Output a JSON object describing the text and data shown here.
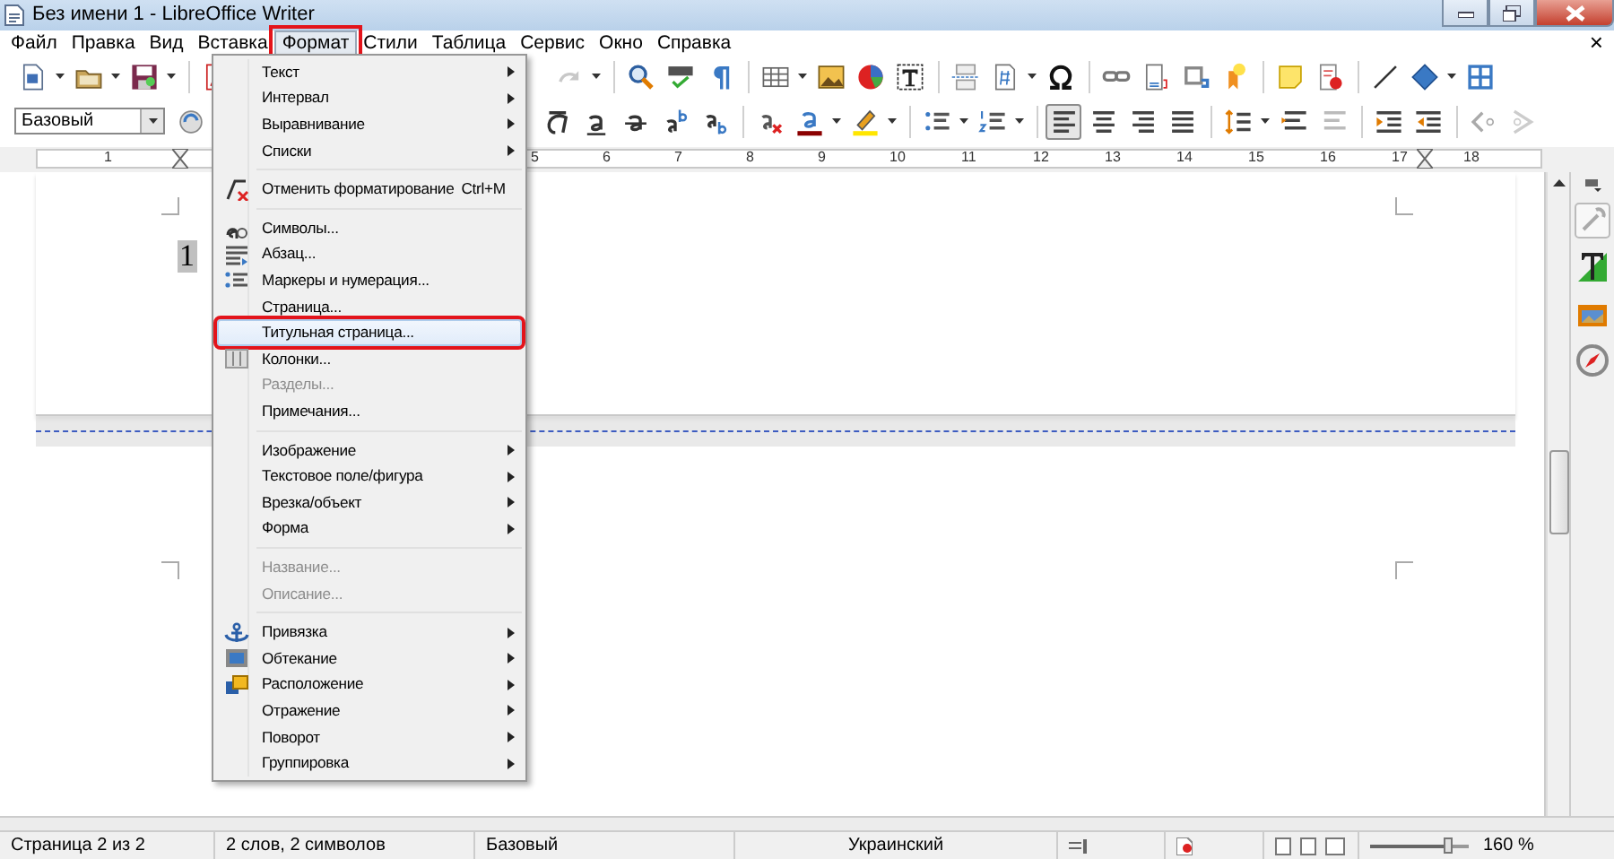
{
  "window": {
    "title": "Без имени 1 - LibreOffice Writer"
  },
  "menubar": [
    {
      "label": "Файл",
      "selected": false,
      "annotated": false
    },
    {
      "label": "Правка",
      "selected": false,
      "annotated": false
    },
    {
      "label": "Вид",
      "selected": false,
      "annotated": false
    },
    {
      "label": "Вставка",
      "selected": false,
      "annotated": false
    },
    {
      "label": "Формат",
      "selected": true,
      "annotated": true
    },
    {
      "label": "Стили",
      "selected": false,
      "annotated": false
    },
    {
      "label": "Таблица",
      "selected": false,
      "annotated": false
    },
    {
      "label": "Сервис",
      "selected": false,
      "annotated": false
    },
    {
      "label": "Окно",
      "selected": false,
      "annotated": false
    },
    {
      "label": "Справка",
      "selected": false,
      "annotated": false
    }
  ],
  "close_document": "×",
  "formatting_toolbar": {
    "paragraph_style": "Базовый",
    "align_left_pressed": true
  },
  "ruler": [
    {
      "label": "1"
    },
    {
      "label": "5"
    },
    {
      "label": "6"
    },
    {
      "label": "7"
    },
    {
      "label": "8"
    },
    {
      "label": "9"
    },
    {
      "label": "10"
    },
    {
      "label": "11"
    },
    {
      "label": "12"
    },
    {
      "label": "13"
    },
    {
      "label": "14"
    },
    {
      "label": "15"
    },
    {
      "label": "16"
    },
    {
      "label": "17"
    },
    {
      "label": "18"
    }
  ],
  "document": {
    "page_number_field": "1"
  },
  "format_menu": [
    {
      "kind": "item",
      "label": "Текст",
      "submenu": true,
      "disabled": false,
      "selected": false,
      "annotated": false
    },
    {
      "kind": "item",
      "label": "Интервал",
      "submenu": true,
      "disabled": false,
      "selected": false,
      "annotated": false
    },
    {
      "kind": "item",
      "label": "Выравнивание",
      "submenu": true,
      "disabled": false,
      "selected": false,
      "annotated": false
    },
    {
      "kind": "item",
      "label": "Списки",
      "submenu": true,
      "disabled": false,
      "selected": false,
      "annotated": false
    },
    {
      "kind": "separator"
    },
    {
      "kind": "item",
      "label": "Отменить форматирование",
      "shortcut": "Ctrl+M",
      "submenu": false,
      "disabled": false,
      "selected": false,
      "annotated": false
    },
    {
      "kind": "separator"
    },
    {
      "kind": "item",
      "label": "Символы...",
      "submenu": false,
      "disabled": false,
      "selected": false,
      "annotated": false
    },
    {
      "kind": "item",
      "label": "Абзац...",
      "submenu": false,
      "disabled": false,
      "selected": false,
      "annotated": false
    },
    {
      "kind": "item",
      "label": "Маркеры и нумерация...",
      "submenu": false,
      "disabled": false,
      "selected": false,
      "annotated": false
    },
    {
      "kind": "item",
      "label": "Страница...",
      "submenu": false,
      "disabled": false,
      "selected": false,
      "annotated": false
    },
    {
      "kind": "item",
      "label": "Титульная страница...",
      "submenu": false,
      "disabled": false,
      "selected": true,
      "annotated": true
    },
    {
      "kind": "item",
      "label": "Колонки...",
      "submenu": false,
      "disabled": false,
      "selected": false,
      "annotated": false
    },
    {
      "kind": "item",
      "label": "Разделы...",
      "submenu": false,
      "disabled": true,
      "selected": false,
      "annotated": false
    },
    {
      "kind": "item",
      "label": "Примечания...",
      "submenu": false,
      "disabled": false,
      "selected": false,
      "annotated": false
    },
    {
      "kind": "separator"
    },
    {
      "kind": "item",
      "label": "Изображение",
      "submenu": true,
      "disabled": false,
      "selected": false,
      "annotated": false
    },
    {
      "kind": "item",
      "label": "Текстовое поле/фигура",
      "submenu": true,
      "disabled": false,
      "selected": false,
      "annotated": false
    },
    {
      "kind": "item",
      "label": "Врезка/объект",
      "submenu": true,
      "disabled": false,
      "selected": false,
      "annotated": false
    },
    {
      "kind": "item",
      "label": "Форма",
      "submenu": true,
      "disabled": false,
      "selected": false,
      "annotated": false
    },
    {
      "kind": "separator"
    },
    {
      "kind": "item",
      "label": "Название...",
      "submenu": false,
      "disabled": true,
      "selected": false,
      "annotated": false
    },
    {
      "kind": "item",
      "label": "Описание...",
      "submenu": false,
      "disabled": true,
      "selected": false,
      "annotated": false
    },
    {
      "kind": "separator"
    },
    {
      "kind": "item",
      "label": "Привязка",
      "submenu": true,
      "disabled": false,
      "selected": false,
      "annotated": false
    },
    {
      "kind": "item",
      "label": "Обтекание",
      "submenu": true,
      "disabled": false,
      "selected": false,
      "annotated": false
    },
    {
      "kind": "item",
      "label": "Расположение",
      "submenu": true,
      "disabled": false,
      "selected": false,
      "annotated": false
    },
    {
      "kind": "item",
      "label": "Отражение",
      "submenu": true,
      "disabled": false,
      "selected": false,
      "annotated": false
    },
    {
      "kind": "item",
      "label": "Поворот",
      "submenu": true,
      "disabled": false,
      "selected": false,
      "annotated": false
    },
    {
      "kind": "item",
      "label": "Группировка",
      "submenu": true,
      "disabled": false,
      "selected": false,
      "annotated": false
    }
  ],
  "status_bar": {
    "page": "Страница 2 из 2",
    "words": "2 слов, 2 символов",
    "page_style": "Базовый",
    "language": "Украинский",
    "zoom_slider": {
      "level": 0.78
    },
    "zoom": "160 %"
  }
}
